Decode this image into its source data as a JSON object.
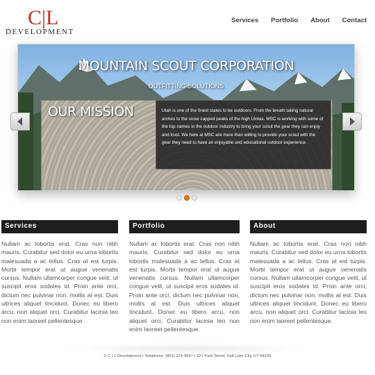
{
  "logo": {
    "mark": "C|L",
    "word": "DEVELOPMENT"
  },
  "nav": [
    {
      "label": "Services"
    },
    {
      "label": "Portfolio"
    },
    {
      "label": "About"
    },
    {
      "label": "Contact"
    }
  ],
  "slider": {
    "title": "MOUNTAIN SCOUT CORPORATION",
    "subtitle": "OUTFITTING SOLUTIONS",
    "mission_heading": "OUR MISSION",
    "caption": "Utah is one of the finest states to be outdoors. From the breath taking natural arches to the snow capped peaks of the high Uintas. MSC is working with some of the top names in the outdoor industry to bring your scout the gear they can enjoy and trust. We here at MSC are more than willing to provide your scout with the gear they need to have an enjoyable and educational outdoor experience.",
    "active_dot": 2,
    "dot_count": 3
  },
  "columns": [
    {
      "heading": "Services",
      "body": "Nullam ac lobortis erat. Cras non nibh mauris. Curabitur sed dolor eu urna lobortis malesuada a ac tellus. Cras at est turpis. Morbi tempor erat ut augue venenatis cursus. Nullam ullamcorper congue velit, ut suscipit eros sodales id. Proin ante orci, dictum nec pulvinar non, mollis at est. Duis ultrices aliquet tincidunt. Donec eu libero arcu, non aliquet orci. Curabitur lacinia leo non enim laoreet pellentesque."
    },
    {
      "heading": "Portfolio",
      "body": "Nullam ac lobortis erat. Cras non nibh mauris. Curabitur sed dolor eu urna lobortis malesuada a ac tellus. Cras at est turpis. Morbi tempor erat ut augue venenatis cursus. Nullam ullamcorper congue velit, ut suscipit eros sodales id. Proin ante orci, dictum nec pulvinar non, mollis at est. Duis ultrices aliquet tincidunt. Donec eu libero arcu, non aliquet orci. Curabitur lacinia leo non enim laoreet pellentesque."
    },
    {
      "heading": "About",
      "body": "Nullam ac lobortis erat. Cras non nibh mauris. Curabitur sed dolor eu urna lobortis malesuada a ac tellus. Cras at est turpis. Morbi tempor erat ut augue venenatis cursus. Nullam ullamcorper congue velit, ut suscipit eros sodales id. Proin ante orci, dictum nec pulvinar non, mollis at est. Duis ultrices aliquet tincidunt. Donec eu libero arcu, non aliquet orci. Curabitur lacinia leo non enim laoreet pellentesque."
    }
  ],
  "footer": "© C | L Development • Telephone: (801) 123-4567 • 321 Park Street, Salt Lake City, UT 84105",
  "colors": {
    "brand_red": "#b5322b",
    "dot_active": "#e07a12",
    "heading_bg": "#1e1e1e"
  }
}
